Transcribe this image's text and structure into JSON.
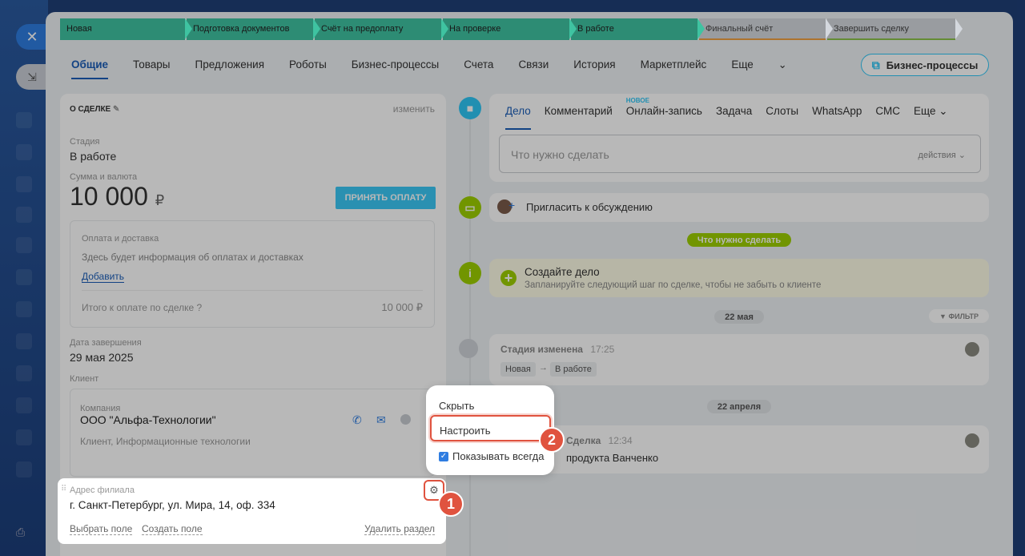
{
  "stages": [
    {
      "label": "Новая",
      "w": 156,
      "type": "g"
    },
    {
      "label": "Подготовка документов",
      "w": 158,
      "type": "g"
    },
    {
      "label": "Счёт на предоплату",
      "w": 158,
      "type": "g"
    },
    {
      "label": "На проверке",
      "w": 158,
      "type": "g"
    },
    {
      "label": "В работе",
      "w": 158,
      "type": "g"
    },
    {
      "label": "Финальный счёт",
      "w": 158,
      "type": "gr",
      "ul": "#f0a040"
    },
    {
      "label": "Завершить сделку",
      "w": 160,
      "type": "gr",
      "ul": "#8bc34a"
    }
  ],
  "tabs": [
    "Общие",
    "Товары",
    "Предложения",
    "Роботы",
    "Бизнес-процессы",
    "Счета",
    "Связи",
    "История",
    "Маркетплейс",
    "Еще"
  ],
  "bp_button": "Бизнес-процессы",
  "deal": {
    "section_title": "О СДЕЛКЕ",
    "edit": "изменить",
    "stage_label": "Стадия",
    "stage_value": "В работе",
    "sum_label": "Сумма и валюта",
    "sum_value": "10 000",
    "currency": "₽",
    "pay_button": "ПРИНЯТЬ ОПЛАТУ",
    "payment_title": "Оплата и доставка",
    "payment_info": "Здесь будет информация об оплатах и доставках",
    "payment_add": "Добавить",
    "total_label": "Итого к оплате по сделке",
    "total_value": "10 000 ₽",
    "close_date_label": "Дата завершения",
    "close_date_value": "29 мая 2025",
    "client_label": "Клиент",
    "company_label": "Компания",
    "company_name": "ООО \"Альфа-Технологии\"",
    "company_type": "Клиент, Информационные технологии",
    "address_label": "Адрес филиала",
    "address_value": "г. Санкт-Петербург, ул. Мира, 14, оф. 334",
    "select_field": "Выбрать поле",
    "create_field": "Создать поле",
    "delete_section": "Удалить раздел"
  },
  "right": {
    "tabs": [
      "Дело",
      "Комментарий",
      "Онлайн-запись",
      "Задача",
      "Слоты",
      "WhatsApp",
      "СМС",
      "Еще"
    ],
    "new_badge": "НОВОЕ",
    "todo_placeholder": "Что нужно сделать",
    "actions": "действия",
    "invite": "Пригласить к обсуждению",
    "todo_pill": "Что нужно сделать",
    "create_title": "Создайте дело",
    "create_sub": "Запланируйте следующий шаг по сделке, чтобы не забыть о клиенте",
    "date1": "22 мая",
    "filter": "ФИЛЬТР",
    "stage_changed": "Стадия изменена",
    "stage_time": "17:25",
    "from_stage": "Новая",
    "to_stage": "В работе",
    "date2": "22 апреля",
    "item2_title": "Сделка",
    "item2_time": "12:34",
    "item2_text": "продукта Ванченко"
  },
  "popup": {
    "hide": "Скрыть",
    "configure": "Настроить",
    "show_always": "Показывать всегда"
  },
  "badges": [
    "1",
    "2"
  ]
}
